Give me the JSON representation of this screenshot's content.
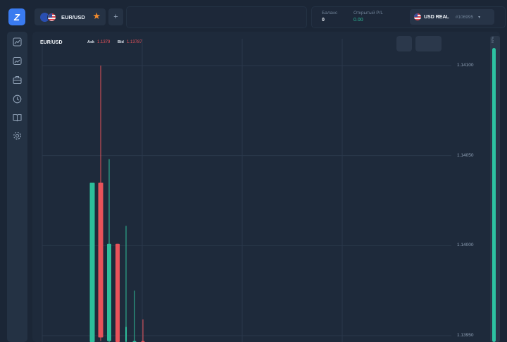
{
  "app": {
    "logo_letter": "Z"
  },
  "tabs": [
    {
      "label": "EUR/USD",
      "favorite": true
    }
  ],
  "add_tab_label": "+",
  "stats": {
    "balance_label": "Баланс",
    "balance_value": "0",
    "pl_label": "Открытый P/L",
    "pl_value": "0.00"
  },
  "account": {
    "name": "USD REAL",
    "id": "#106995"
  },
  "sidebar": {
    "items": [
      {
        "icon": "chart-trend-icon"
      },
      {
        "icon": "image-chart-icon"
      },
      {
        "icon": "briefcase-icon"
      },
      {
        "icon": "clock-icon"
      },
      {
        "icon": "book-icon"
      },
      {
        "icon": "gear-icon"
      }
    ]
  },
  "chart_header": {
    "symbol": "EUR/USD",
    "ask_label": "Ask",
    "ask_value": "1.1379",
    "bid_label": "Bid",
    "bid_value": "1.13787"
  },
  "side_scale_label": "97%",
  "colors": {
    "up": "#2dbd9a",
    "down": "#e8525a",
    "accent": "#3a7bf0",
    "star": "#f08a2c"
  },
  "chart_data": {
    "type": "candlestick",
    "price_ticks": [
      "1.14100",
      "1.14050",
      "1.14000",
      "1.13950"
    ],
    "ylim": [
      1.13939,
      1.14115
    ],
    "candles": [
      {
        "dir": "up",
        "open": 1.13922,
        "close": 1.14035,
        "high": 1.14035,
        "low": 1.13922
      },
      {
        "dir": "down",
        "open": 1.14035,
        "close": 1.13949,
        "high": 1.141,
        "low": 1.13947
      },
      {
        "dir": "up",
        "open": 1.13947,
        "close": 1.14001,
        "high": 1.14048,
        "low": 1.1394
      },
      {
        "dir": "down",
        "open": 1.14001,
        "close": 1.13945,
        "high": 1.14001,
        "low": 1.1394
      },
      {
        "dir": "up",
        "open": 1.1394,
        "close": 1.13955,
        "high": 1.14011,
        "low": 1.1394
      },
      {
        "dir": "up",
        "open": 1.13945,
        "close": 1.13947,
        "high": 1.13975,
        "low": 1.1394
      },
      {
        "dir": "down",
        "open": 1.13947,
        "close": 1.13945,
        "high": 1.13959,
        "low": 1.1394
      }
    ]
  }
}
